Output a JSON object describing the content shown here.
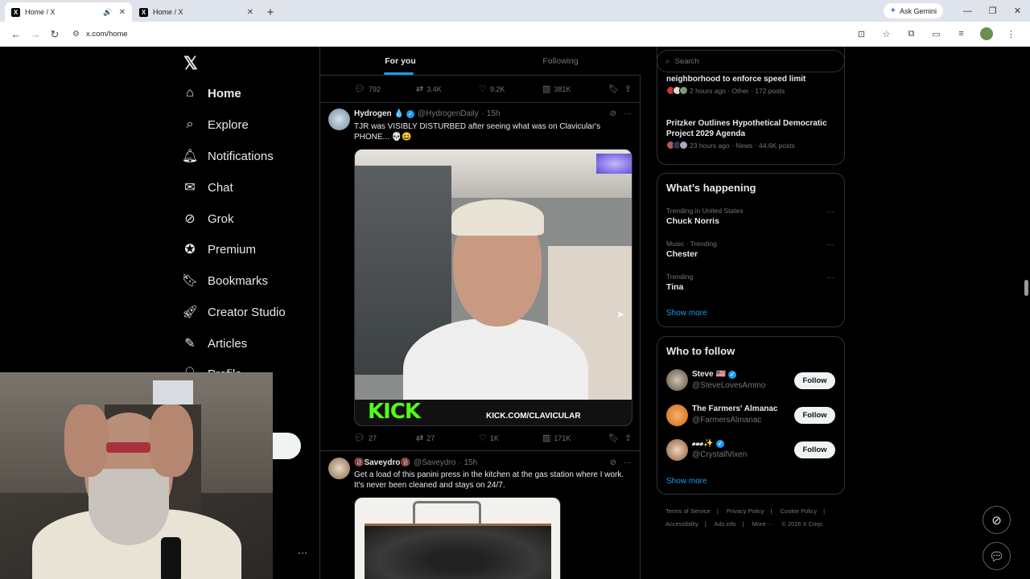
{
  "browser": {
    "tabs": [
      {
        "title": "Home / X",
        "active": true
      },
      {
        "title": "Home / X",
        "active": false
      }
    ],
    "gemini_label": "Ask Gemini",
    "url": "x.com/home"
  },
  "nav": {
    "items": [
      {
        "label": "Home",
        "icon": "home-icon"
      },
      {
        "label": "Explore",
        "icon": "search-icon"
      },
      {
        "label": "Notifications",
        "icon": "bell-icon"
      },
      {
        "label": "Chat",
        "icon": "mail-icon"
      },
      {
        "label": "Grok",
        "icon": "grok-icon"
      },
      {
        "label": "Premium",
        "icon": "premium-icon"
      },
      {
        "label": "Bookmarks",
        "icon": "bookmark-icon"
      },
      {
        "label": "Creator Studio",
        "icon": "rocket-icon"
      },
      {
        "label": "Articles",
        "icon": "article-icon"
      },
      {
        "label": "Profile",
        "icon": "person-icon"
      }
    ],
    "more": "···"
  },
  "feed": {
    "tabs": [
      "For you",
      "Following"
    ],
    "top_actions": {
      "replies": "792",
      "reposts": "3.4K",
      "likes": "9.2K",
      "views": "381K"
    },
    "tweets": [
      {
        "name": "Hydrogen 💧",
        "handle": "@HydrogenDaily",
        "time": "· 15h",
        "text": "TJR was VISIBLY DISTURBED after seeing what was on Clavicular's PHONE... 💀😆",
        "media_brand": "KICK",
        "media_url": "KICK.COM/CLAVICULAR",
        "replies": "27",
        "reposts": "27",
        "likes": "1K",
        "views": "171K"
      },
      {
        "name_prefix": "🔞",
        "name": "Saveydro",
        "name_suffix": "🔞",
        "handle": "@Saveydro",
        "time": "· 15h",
        "text": "Get a load of this panini press in the kitchen at the gas station where I work. It's never been cleaned and stays on 24/7."
      }
    ]
  },
  "search": {
    "placeholder": "Search"
  },
  "news": [
    {
      "title": "neighborhood to enforce speed limit",
      "meta": "2 hours ago · Other · 172 posts"
    },
    {
      "title": "Pritzker Outlines Hypothetical Democratic Project 2029 Agenda",
      "meta": "23 hours ago · News · 44.6K posts"
    }
  ],
  "happening": {
    "title": "What’s happening",
    "trends": [
      {
        "context": "Trending in United States",
        "name": "Chuck Norris"
      },
      {
        "context": "Music · Trending",
        "name": "Chester"
      },
      {
        "context": "Trending",
        "name": "Tina"
      }
    ],
    "show_more": "Show more"
  },
  "who_to_follow": {
    "title": "Who to follow",
    "accounts": [
      {
        "name": "Steve 🇺🇸",
        "handle": "@SteveLovesAmmo",
        "button": "Follow"
      },
      {
        "name": "The Farmers' Almanac",
        "handle": "@FarmersAlmanac",
        "button": "Follow"
      },
      {
        "name": "𝓮𝓿𝓮✨",
        "handle": "@CrystallVixen",
        "button": "Follow"
      }
    ],
    "show_more": "Show more"
  },
  "footer": {
    "links": [
      "Terms of Service",
      "Privacy Policy",
      "Cookie Policy",
      "Accessibility",
      "Ads info",
      "More ···",
      "© 2026 X Corp."
    ],
    "separator": "|"
  },
  "colors": {
    "accent": "#1d9bf0",
    "border": "#2f3336",
    "muted": "#71767b",
    "kick_green": "#53fc18"
  }
}
